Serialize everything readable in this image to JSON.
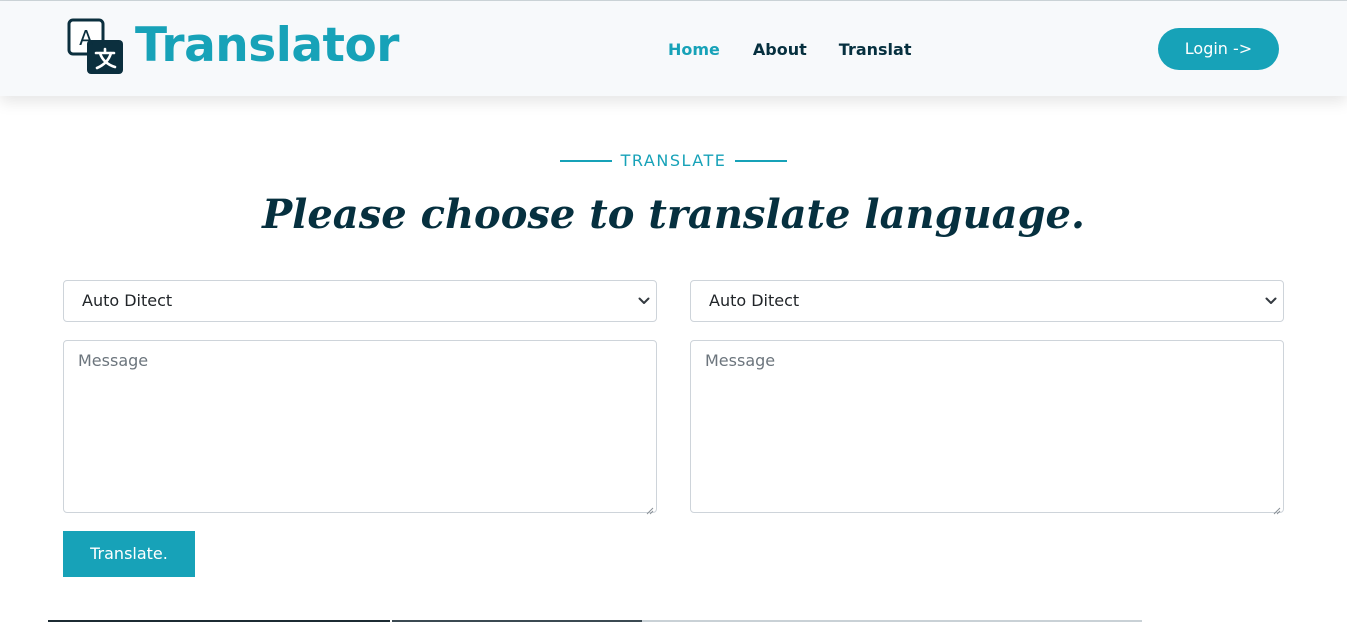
{
  "header": {
    "brand": "Translator",
    "icon_glyph_a": "A",
    "icon_glyph_b": "文",
    "nav": [
      "Home",
      "About",
      "Translat"
    ],
    "login_label": "Login ->"
  },
  "section": {
    "tag": "TRANSLATE",
    "heading": "Please choose to translate language."
  },
  "form": {
    "source_language": "Auto Ditect",
    "target_language": "Auto Ditect",
    "source_placeholder": "Message",
    "target_placeholder": "Message",
    "submit_label": "Translate."
  },
  "colors": {
    "accent": "#17a2b8",
    "text_dark": "#06303f",
    "border": "#ced4da",
    "placeholder": "#6c757d"
  },
  "icons": {
    "brand": "translate-icon",
    "select": "chevron-down-icon"
  }
}
